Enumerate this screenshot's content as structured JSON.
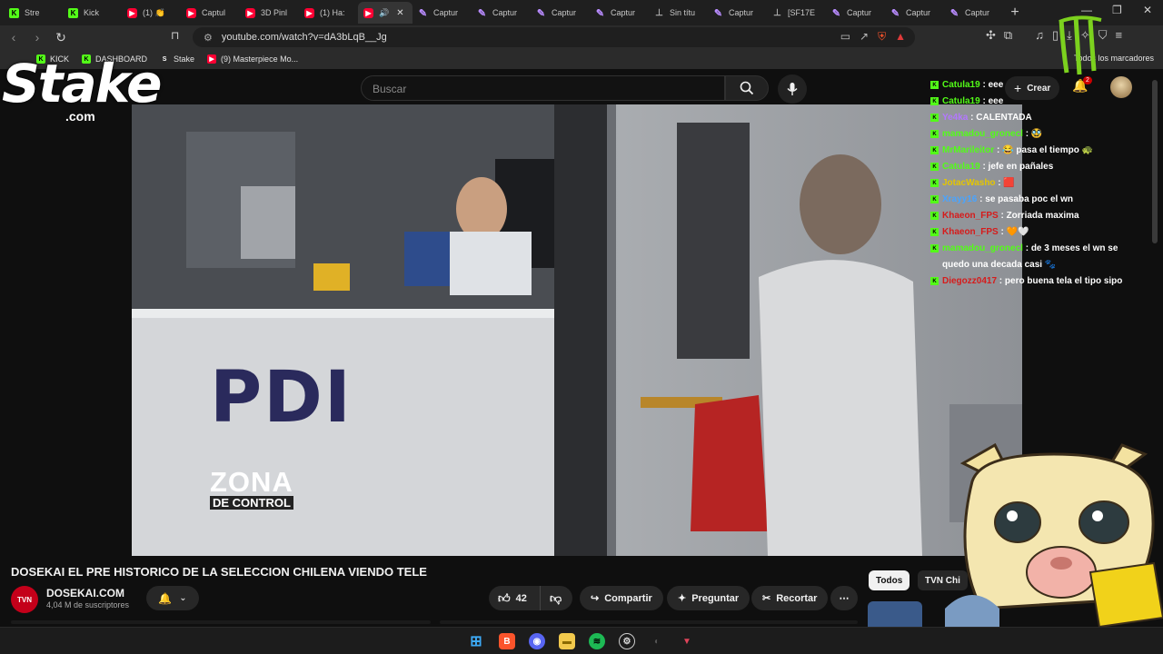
{
  "browser": {
    "tabs": [
      {
        "label": "Stre",
        "icon": "kick"
      },
      {
        "label": "Kick",
        "icon": "kick"
      },
      {
        "label": "(1) 👏",
        "icon": "youtube"
      },
      {
        "label": "Captul",
        "icon": "youtube"
      },
      {
        "label": "3D Pinl",
        "icon": "youtube"
      },
      {
        "label": "(1) Ha:",
        "icon": "youtube"
      },
      {
        "label": "",
        "icon": "youtube",
        "active": true
      },
      {
        "label": "Captur",
        "icon": "pen"
      },
      {
        "label": "Captur",
        "icon": "pen"
      },
      {
        "label": "Captur",
        "icon": "pen"
      },
      {
        "label": "Captur",
        "icon": "pen"
      },
      {
        "label": "Sin títu",
        "icon": "doc"
      },
      {
        "label": "Captur",
        "icon": "pen"
      },
      {
        "label": "[SF17E",
        "icon": "doc"
      },
      {
        "label": "Captur",
        "icon": "pen"
      },
      {
        "label": "Captur",
        "icon": "pen"
      },
      {
        "label": "Captur",
        "icon": "pen"
      }
    ],
    "url": "youtube.com/watch?v=dA3bLqB__Jg",
    "bookmarks": [
      {
        "label": "KICK",
        "icon": "kick"
      },
      {
        "label": "DASHBOARD",
        "icon": "kick"
      },
      {
        "label": "Stake",
        "icon": "stake"
      },
      {
        "label": "(9) Masterpiece Mo...",
        "icon": "youtube"
      }
    ],
    "all_bookmarks_label": "Todos los marcadores"
  },
  "youtube": {
    "search_placeholder": "Buscar",
    "create_label": "Crear",
    "notification_count": "2",
    "video_title": "DOSEKAI EL PRE HISTORICO DE LA SELECCION CHILENA VIENDO TELE",
    "channel_name": "DOSEKAI.COM",
    "channel_avatar_text": "TVN",
    "subscribers": "4,04 M de suscriptores",
    "likes": "42",
    "share_label": "Compartir",
    "ask_label": "Preguntar",
    "clip_label": "Recortar",
    "chips": [
      "Todos",
      "TVN Chi"
    ]
  },
  "video": {
    "sign_text": "PDI",
    "caption_line1": "ZONA",
    "caption_line2": "DE CONTROL"
  },
  "overlay": {
    "stake_word": "Stake",
    "stake_domain": ".com",
    "chat": [
      {
        "user": "Catula19",
        "color": "#53fc18",
        "text": "eee"
      },
      {
        "user": "Catula19",
        "color": "#53fc18",
        "text": "eee"
      },
      {
        "user": "Ye4ka",
        "color": "#b377ff",
        "text": "CALENTADA"
      },
      {
        "user": "mamadou_gronecl",
        "color": "#53fc18",
        "text": "🥸"
      },
      {
        "user": "MrMarileitor",
        "color": "#53fc18",
        "text": "😂 pasa el tiempo 🐢"
      },
      {
        "user": "Catula19",
        "color": "#53fc18",
        "text": "jefe en pañales"
      },
      {
        "user": "JotacWasho",
        "color": "#e5c600",
        "text": "🟥"
      },
      {
        "user": "Xrayy16",
        "color": "#49a4ff",
        "text": "se pasaba poc el wn"
      },
      {
        "user": "Khaeon_FPS",
        "color": "#d61b1b",
        "text": "Zorriada maxima"
      },
      {
        "user": "Khaeon_FPS",
        "color": "#d61b1b",
        "text": "🧡🤍"
      },
      {
        "user": "mamadou_gronecl",
        "color": "#53fc18",
        "text": "de 3 meses el wn se quedo una decada casi 🐾"
      },
      {
        "user": "Diegozz0417",
        "color": "#d61b1b",
        "text": "pero buena tela el tipo sipo"
      }
    ]
  }
}
